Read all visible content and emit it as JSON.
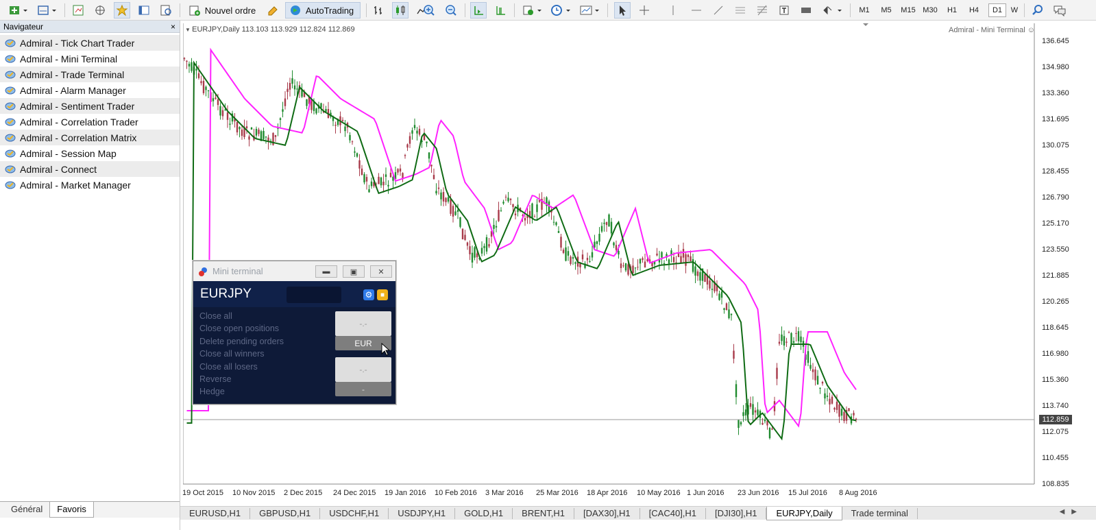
{
  "toolbar": {
    "new_order_label": "Nouvel ordre",
    "autotrading_label": "AutoTrading",
    "timeframes": [
      "M1",
      "M5",
      "M15",
      "M30",
      "H1",
      "H4",
      "D1",
      "W"
    ],
    "active_timeframe": "D1"
  },
  "navigator": {
    "title": "Navigateur",
    "close": "×",
    "items": [
      {
        "label": "Admiral - Tick Chart Trader"
      },
      {
        "label": "Admiral - Mini Terminal"
      },
      {
        "label": "Admiral - Trade Terminal"
      },
      {
        "label": "Admiral - Alarm Manager"
      },
      {
        "label": "Admiral - Sentiment Trader"
      },
      {
        "label": "Admiral - Correlation Trader"
      },
      {
        "label": "Admiral - Correlation Matrix"
      },
      {
        "label": "Admiral - Session Map"
      },
      {
        "label": "Admiral - Connect"
      },
      {
        "label": "Admiral - Market Manager"
      }
    ],
    "tabs": [
      "Général",
      "Favoris"
    ],
    "active_tab": "Favoris"
  },
  "chart": {
    "title": "EURJPY,Daily  113.103 113.929 112.824 112.869",
    "ea_label": "Admiral - Mini Terminal",
    "price_labels": [
      "136.645",
      "134.980",
      "133.360",
      "131.695",
      "130.075",
      "128.455",
      "126.790",
      "125.170",
      "123.550",
      "121.885",
      "120.265",
      "118.645",
      "116.980",
      "115.360",
      "113.740",
      "112.075",
      "110.455",
      "108.835"
    ],
    "current_price": "112.859",
    "date_labels": [
      "19 Oct 2015",
      "10 Nov 2015",
      "2 Dec 2015",
      "24 Dec 2015",
      "19 Jan 2016",
      "10 Feb 2016",
      "3 Mar 2016",
      "25 Mar 2016",
      "18 Apr 2016",
      "10 May 2016",
      "1 Jun 2016",
      "23 Jun 2016",
      "15 Jul 2016",
      "8 Aug 2016"
    ],
    "colors": {
      "bull": "#1f8a2e",
      "bear": "#a83a4a",
      "ma_fast": "#0f6b14",
      "ma_slow": "#ff22ff"
    }
  },
  "bottom_tabs": [
    "EURUSD,H1",
    "GBPUSD,H1",
    "USDCHF,H1",
    "USDJPY,H1",
    "GOLD,H1",
    "BRENT,H1",
    "[DAX30],H1",
    "[CAC40],H1",
    "[DJI30],H1",
    "EURJPY,Daily",
    "Trade terminal"
  ],
  "active_bottom_tab": "EURJPY,Daily",
  "mini_terminal": {
    "title": "Mini terminal",
    "symbol": "EURJPY",
    "actions": [
      "Close all",
      "Close open positions",
      "Delete pending orders",
      "Close all winners",
      "Close all losers",
      "Reverse",
      "Hedge"
    ],
    "btn_top": "-.-",
    "btn_currency": "EUR",
    "btn_bottom": "-.-",
    "btn_dash": "-"
  }
}
